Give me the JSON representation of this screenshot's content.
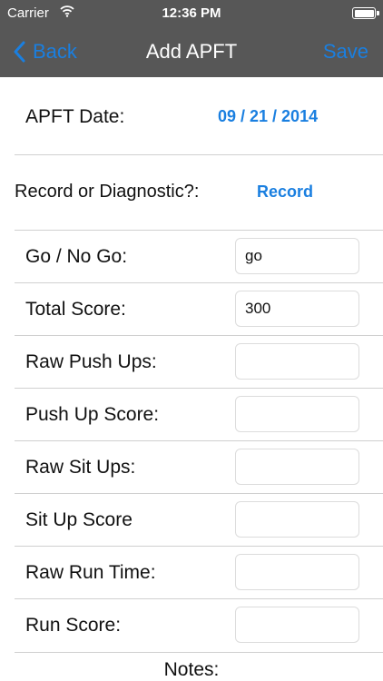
{
  "status_bar": {
    "carrier": "Carrier",
    "time": "12:36 PM"
  },
  "nav": {
    "back_label": "Back",
    "title": "Add APFT",
    "save_label": "Save"
  },
  "date_row": {
    "label": "APFT Date:",
    "value": "09 / 21 / 2014"
  },
  "record_row": {
    "label": "Record or Diagnostic?:",
    "value": "Record"
  },
  "fields": [
    {
      "label": "Go / No Go:",
      "value": "go"
    },
    {
      "label": "Total Score:",
      "value": "300"
    },
    {
      "label": "Raw Push Ups:",
      "value": ""
    },
    {
      "label": "Push Up Score:",
      "value": ""
    },
    {
      "label": "Raw Sit Ups:",
      "value": ""
    },
    {
      "label": "Sit Up Score",
      "value": ""
    },
    {
      "label": "Raw Run Time:",
      "value": ""
    },
    {
      "label": "Run Score:",
      "value": ""
    }
  ],
  "notes": {
    "label": "Notes:"
  },
  "colors": {
    "bar": "#575757",
    "accent": "#1a7fe0",
    "separator": "#d0d0d0"
  },
  "icons": {
    "back": "chevron-left-icon",
    "wifi": "wifi-icon",
    "battery": "battery-icon"
  }
}
